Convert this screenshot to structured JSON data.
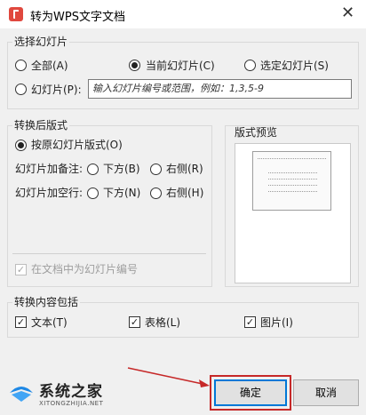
{
  "window": {
    "title": "转为WPS文字文档"
  },
  "slide_selection": {
    "legend": "选择幻灯片",
    "all_label": "全部(A)",
    "current_label": "当前幻灯片(C)",
    "selected_label": "选定幻灯片(S)",
    "slides_label": "幻灯片(P):",
    "range_placeholder": "输入幻灯片编号或范围，例如：1,3,5-9"
  },
  "layout": {
    "legend": "转换后版式",
    "original_label": "按原幻灯片版式(O)",
    "notes_row_label": "幻灯片加备注:",
    "notes_below": "下方(B)",
    "notes_right": "右侧(R)",
    "blank_row_label": "幻灯片加空行:",
    "blank_below": "下方(N)",
    "blank_right": "右侧(H)",
    "number_label": "在文档中为幻灯片编号"
  },
  "preview": {
    "legend": "版式预览"
  },
  "content": {
    "legend": "转换内容包括",
    "text_label": "文本(T)",
    "table_label": "表格(L)",
    "image_label": "图片(I)"
  },
  "buttons": {
    "ok": "确定",
    "cancel": "取消"
  },
  "watermark": {
    "name": "系统之家",
    "url": "XITONGZHIJIA.NET"
  },
  "colors": {
    "annotation_red": "#c62828",
    "primary_border": "#0078d7"
  }
}
